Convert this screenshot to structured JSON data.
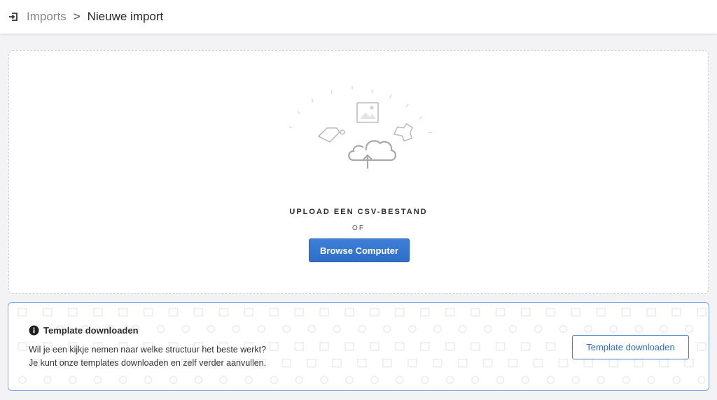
{
  "header": {
    "breadcrumb_parent": "Imports",
    "breadcrumb_separator": ">",
    "breadcrumb_current": "Nieuwe import"
  },
  "upload": {
    "title": "UPLOAD EEN CSV-BESTAND",
    "or_text": "OF",
    "browse_label": "Browse Computer"
  },
  "template": {
    "title": "Template downloaden",
    "line1": "Wil je een kijkje nemen naar welke structuur het beste werkt?",
    "line2": "Je kunt onze templates downloaden en zelf verder aanvullen.",
    "button_label": "Template downloaden"
  },
  "colors": {
    "accent": "#2f6ec7",
    "panel_border": "#7fa7dc",
    "page_bg": "#f3f3f5"
  },
  "icons": {
    "back": "import-arrow-icon",
    "info": "info-icon",
    "upload": "cloud-upload-icon"
  }
}
